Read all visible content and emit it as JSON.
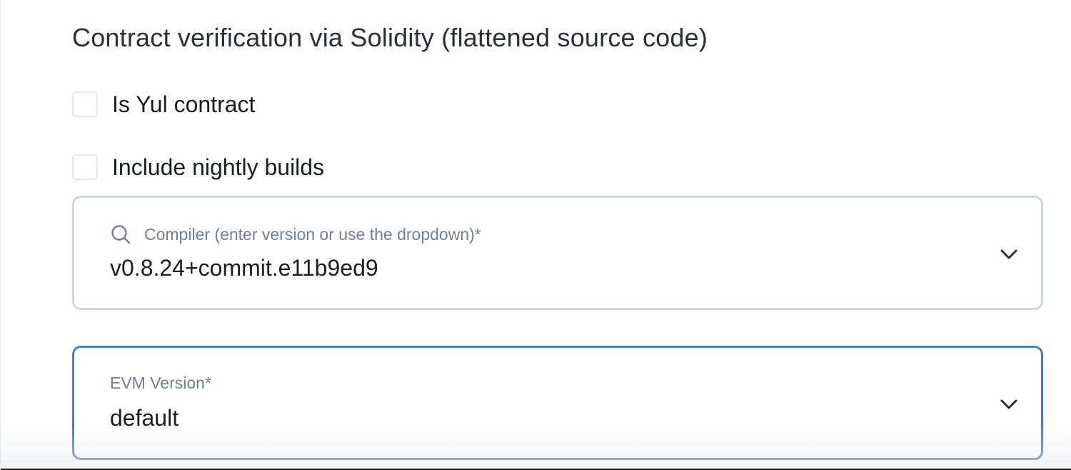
{
  "page": {
    "title": "Contract verification via Solidity (flattened source code)"
  },
  "options": {
    "is_yul_label": "Is Yul contract",
    "is_yul_checked": false,
    "nightly_label": "Include nightly builds",
    "nightly_checked": false
  },
  "compiler": {
    "label": "Compiler (enter version or use the dropdown)*",
    "value": "v0.8.24+commit.e11b9ed9",
    "icon": "search-icon"
  },
  "evm": {
    "label": "EVM Version*",
    "value": "default"
  },
  "colors": {
    "focus_border": "#4a7fc7",
    "default_border": "#cfd6e0",
    "label_gray": "#718096"
  }
}
